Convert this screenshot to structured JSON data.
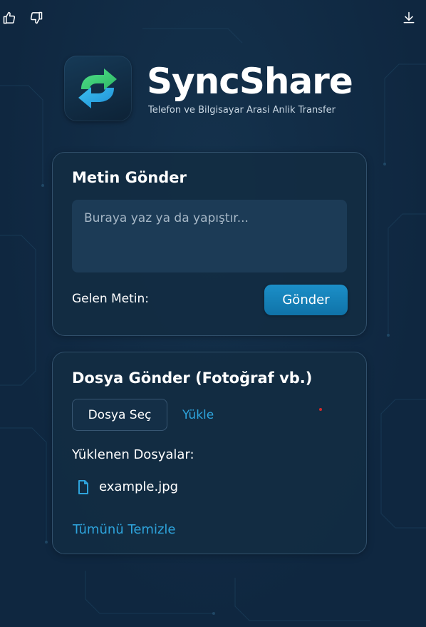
{
  "brand": {
    "title": "SyncShare",
    "subtitle": "Telefon ve Bilgisayar Arasi Anlik Transfer",
    "logo_icon": "sync-arrows-icon"
  },
  "toolbar": {
    "icons": [
      "thumbs-up-icon",
      "thumbs-down-icon",
      "download-icon"
    ]
  },
  "text_card": {
    "heading": "Metin Gönder",
    "placeholder": "Buraya yaz ya da yapıştır...",
    "value": "",
    "incoming_label": "Gelen Metin:",
    "send_label": "Gönder"
  },
  "file_card": {
    "heading": "Dosya Gönder (Fotoğraf vb.)",
    "choose_label": "Dosya Seç",
    "upload_label": "Yükle",
    "uploaded_heading": "Yüklenen Dosyalar:",
    "files": [
      {
        "name": "example.jpg",
        "icon": "file-icon"
      }
    ],
    "clear_label": "Tümünü Temizle"
  },
  "colors": {
    "background": "#0f2740",
    "accent": "#2ea4dc",
    "button": "#1c8fc8",
    "logo_green": "#3fcf7a",
    "logo_blue": "#28a8e6"
  }
}
